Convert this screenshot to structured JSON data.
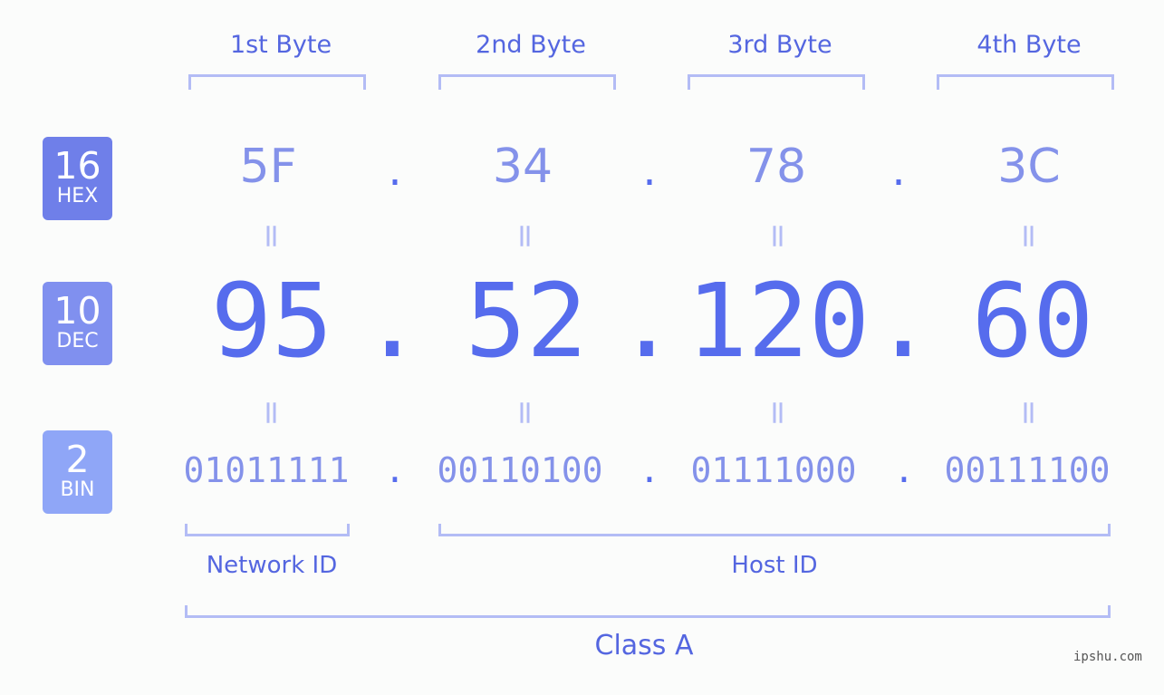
{
  "bytes": [
    {
      "label": "1st Byte",
      "hex": "5F",
      "dec": "95",
      "bin": "01011111"
    },
    {
      "label": "2nd Byte",
      "hex": "34",
      "dec": "52",
      "bin": "00110100"
    },
    {
      "label": "3rd Byte",
      "hex": "78",
      "dec": "120",
      "bin": "01111000"
    },
    {
      "label": "4th Byte",
      "hex": "3C",
      "dec": "60",
      "bin": "00111100"
    }
  ],
  "badges": {
    "hex": {
      "base": "16",
      "name": "HEX",
      "color": "#6f7fe9"
    },
    "dec": {
      "base": "10",
      "name": "DEC",
      "color": "#8090ef"
    },
    "bin": {
      "base": "2",
      "name": "BIN",
      "color": "#8fa6f7"
    }
  },
  "separator": ".",
  "equals": "=",
  "network_id_label": "Network ID",
  "host_id_label": "Host ID",
  "class_label": "Class A",
  "watermark": "ipshu.com",
  "colors": {
    "accent": "#566ced",
    "light": "#8492ea",
    "bracket": "#b3bcf5"
  }
}
